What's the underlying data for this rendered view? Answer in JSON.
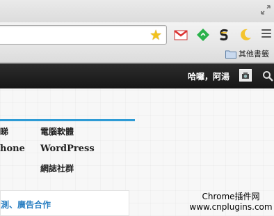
{
  "browser": {
    "bookmarks": {
      "other_folder_label": "其他書籤"
    }
  },
  "site": {
    "header": {
      "greeting": "哈囉，阿湯"
    },
    "menu": {
      "col1": [
        "睇",
        "hone"
      ],
      "col2": [
        "電腦軟體",
        "WordPress",
        "網誌社群"
      ]
    },
    "bottom_link": "測、廣告合作"
  },
  "watermark": {
    "line1": "Chrome插件网",
    "line2": "www.cnplugins.com"
  },
  "colors": {
    "accent": "#2e9bd5",
    "link": "#2a7fc2",
    "nav_bg": "#1e1e1e"
  }
}
